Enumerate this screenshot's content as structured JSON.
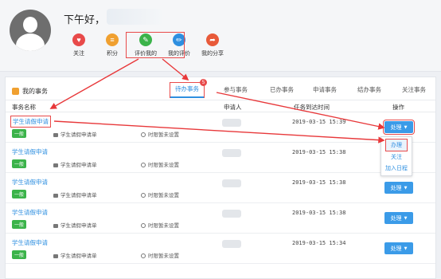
{
  "profile": {
    "greeting": "下午好，",
    "actions": [
      {
        "label": "关注",
        "icon": "heart-icon",
        "color": "#e84a4a",
        "glyph": "♥"
      },
      {
        "label": "积分",
        "icon": "coins-icon",
        "color": "#f0a030",
        "glyph": "≡"
      },
      {
        "label": "评价我的",
        "icon": "review-me-icon",
        "color": "#3bb34a",
        "glyph": "✎"
      },
      {
        "label": "我的评价",
        "icon": "pencil-icon",
        "color": "#2e8fe0",
        "glyph": "✏"
      },
      {
        "label": "我的分享",
        "icon": "share-icon",
        "color": "#e85a3a",
        "glyph": "➦"
      }
    ]
  },
  "panel": {
    "title": "我的事务",
    "tabs": [
      {
        "label": "待办事务",
        "active": true,
        "badge": "5"
      },
      {
        "label": "参与事务"
      },
      {
        "label": "已办事务"
      },
      {
        "label": "申请事务"
      },
      {
        "label": "结办事务"
      },
      {
        "label": "关注事务"
      }
    ],
    "columns": {
      "name": "事务名称",
      "applicant": "申请人",
      "deadline": "任务到达时间",
      "action": "操作"
    }
  },
  "rows": [
    {
      "title": "学生请假申请",
      "tag": "一般",
      "category": "学生请假申请单",
      "timer": "时限暂未设置",
      "time": "2019-03-15 15:39",
      "button": "处理"
    },
    {
      "title": "学生请假申请",
      "tag": "一般",
      "category": "学生请假申请单",
      "timer": "时限暂未设置",
      "time": "2019-03-15 15:38",
      "button": "处理"
    },
    {
      "title": "学生请假申请",
      "tag": "一般",
      "category": "学生请假申请单",
      "timer": "时限暂未设置",
      "time": "2019-03-15 15:38",
      "button": "处理"
    },
    {
      "title": "学生请假申请",
      "tag": "一般",
      "category": "学生请假申请单",
      "timer": "时限暂未设置",
      "time": "2019-03-15 15:38",
      "button": "处理"
    },
    {
      "title": "学生请假申请",
      "tag": "一般",
      "category": "学生请假申请单",
      "timer": "时限暂未设置",
      "time": "2019-03-15 15:34",
      "button": "处理"
    }
  ],
  "dropdown": [
    "办理",
    "关注",
    "加入日程"
  ]
}
